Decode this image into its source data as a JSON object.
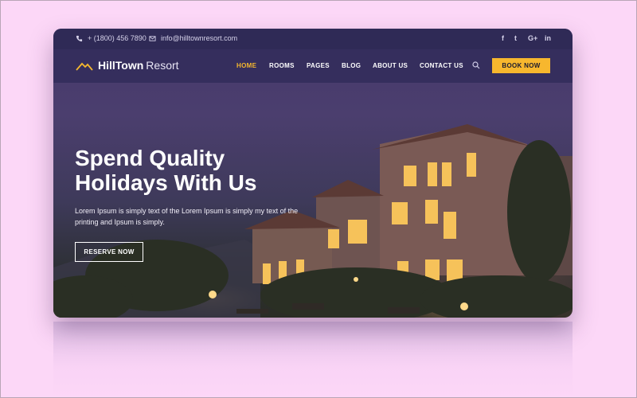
{
  "topbar": {
    "phone": "+ (1800) 456 7890",
    "email": "info@hilltownresort.com",
    "social": [
      {
        "icon": "facebook-icon",
        "label": "f"
      },
      {
        "icon": "twitter-icon",
        "label": "t"
      },
      {
        "icon": "google-plus-icon",
        "label": "G+"
      },
      {
        "icon": "linkedin-icon",
        "label": "in"
      }
    ]
  },
  "brand": {
    "name_strong": "HillTown",
    "name_light": "Resort",
    "accent": "#f5b82e"
  },
  "nav": {
    "items": [
      "HOME",
      "ROOMS",
      "PAGES",
      "BLOG",
      "ABOUT US",
      "CONTACT US"
    ],
    "active": "HOME",
    "book_label": "BOOK NOW"
  },
  "hero": {
    "title_line1": "Spend Quality",
    "title_line2": "Holidays With Us",
    "text": "Lorem Ipsum is simply text of the Lorem Ipsum is simply my text of the printing and Ipsum is simply.",
    "reserve_label": "RESERVE NOW"
  },
  "colors": {
    "page_bg": "#fcd7f7",
    "nav_bg": "#342e5c",
    "button": "#f7b72e"
  }
}
